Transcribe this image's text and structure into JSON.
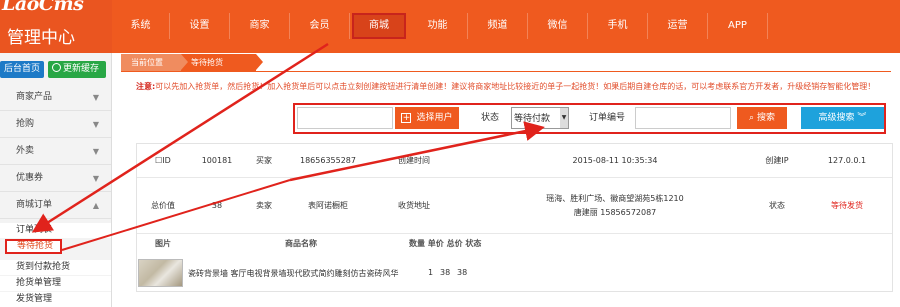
{
  "header": {
    "brand": "LaoCms",
    "title": "管理中心",
    "nav": [
      "系统",
      "设置",
      "商家",
      "会员",
      "商城",
      "功能",
      "频道",
      "微信",
      "手机",
      "运营",
      "APP"
    ],
    "active_nav": "商城"
  },
  "sidebar": {
    "home_label": "后台首页",
    "cache_label": "更新缓存",
    "menus": [
      "商家产品",
      "抢购",
      "外卖",
      "优惠券",
      "商城订单"
    ],
    "submenu": [
      "订单列表",
      "等待抢货",
      "货到付款抢货",
      "抢货单管理",
      "发货管理"
    ]
  },
  "breadcrumb": {
    "current_label": "当前位置",
    "page": "等待抢货"
  },
  "notice": {
    "label": "注意:",
    "text": "可以先加入抢货单，然后抢货！加入抢货单后可以点击立刻创建按钮进行清单创建！建议将商家地址比较接近的单子一起抢货！如果后期自建仓库的话，可以考虑联系官方开发者，升级经销存智能化管理！"
  },
  "search": {
    "select_user_label": "选择用户",
    "status_label": "状态",
    "status_value": "等待付款",
    "order_no_label": "订单编号",
    "search_label": "搜索",
    "advanced_label": "高级搜索"
  },
  "order": {
    "id_label": "ID",
    "id": "100181",
    "buyer_label": "买家",
    "buyer_phone": "18656355287",
    "created_label": "创建时间",
    "created_at": "2015-08-11 10:35:34",
    "ip_label": "创建IP",
    "ip": "127.0.0.1",
    "total_label": "总价值",
    "total": "38",
    "seller_label": "卖家",
    "seller": "表阿诺橱柜",
    "address_label": "收货地址",
    "address_line1": "瑶海、胜利广场、徽商望湖苑5栋1210",
    "address_line2": "唐建丽 15856572087",
    "state_label": "状态",
    "state": "等待发货",
    "goods_headers": {
      "image": "图片",
      "name": "商品名称",
      "qty_price_total_state": "数量 单价 总价 状态"
    },
    "goods": [
      {
        "name": "瓷砖背景墙 客厅电视背景墙现代欧式简约雕刻仿古瓷砖风华",
        "qty": "1",
        "price": "38",
        "total": "38"
      }
    ]
  },
  "colors": {
    "primary_orange": "#ef5a1f",
    "annotation_red": "#e0231c",
    "accent_blue": "#1ea2dc"
  }
}
